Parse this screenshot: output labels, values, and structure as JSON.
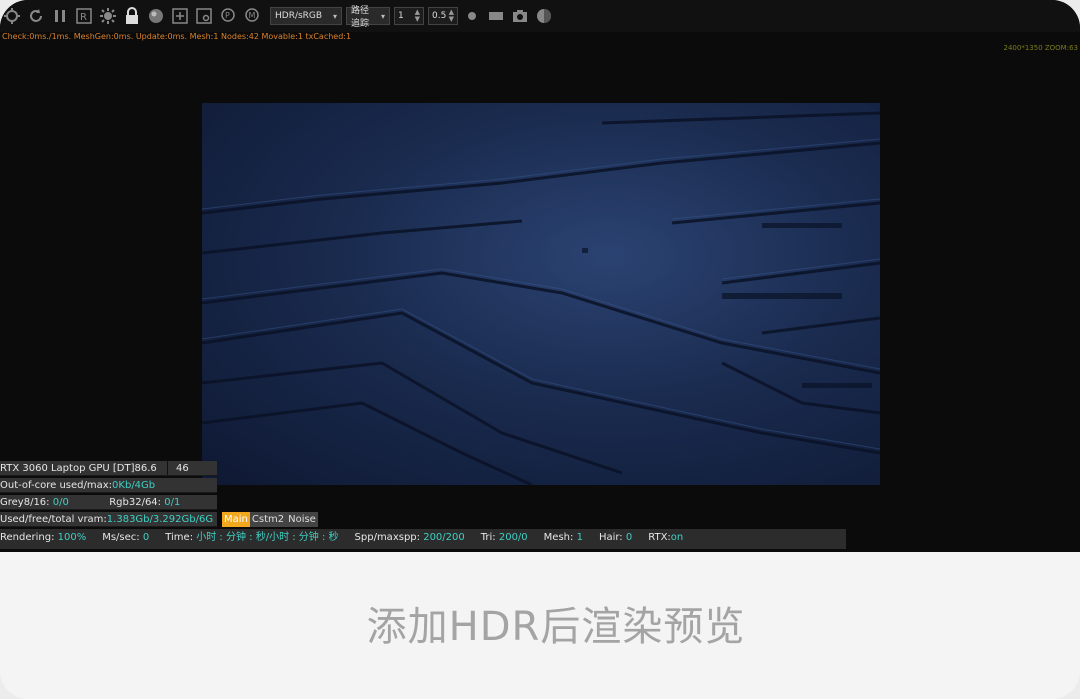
{
  "toolbar": {
    "color_space": "HDR/sRGB",
    "render_mode": "路径追踪",
    "value_a": "1",
    "value_b": "0.5"
  },
  "status_line": "Check:0ms./1ms. MeshGen:0ms. Update:0ms. Mesh:1 Nodes:42 Movable:1 txCached:1",
  "zoom_readout": "2400*1350 ZOOM:63",
  "info": {
    "gpu_name": "RTX 3060 Laptop GPU [DT]",
    "gpu_suffix": "86.6",
    "gpu_value": "46",
    "out_of_core_label": "Out-of-core used/max:",
    "out_of_core_value": "0Kb/4Gb",
    "grey_label": "Grey8/16:",
    "grey_value": "0/0",
    "rgb_label": "Rgb32/64:",
    "rgb_value": "0/1",
    "vram_label": "Used/free/total vram:",
    "vram_value": "1.383Gb/3.292Gb/6G"
  },
  "tabs": [
    "Main",
    "Cstm2",
    "Noise"
  ],
  "render_bar": {
    "rendering_label": "Rendering:",
    "rendering_value": "100%",
    "ms_label": "Ms/sec:",
    "ms_value": "0",
    "time_label": "Time:",
    "time_value": "小时 : 分钟 : 秒/小时 : 分钟 : 秒",
    "spp_label": "Spp/maxspp:",
    "spp_value": "200/200",
    "tri_label": "Tri:",
    "tri_value": "200/0",
    "mesh_label": "Mesh:",
    "mesh_value": "1",
    "hair_label": "Hair:",
    "hair_value": "0",
    "rtx_label": "RTX:",
    "rtx_value": "on"
  },
  "caption": "添加HDR后渲染预览",
  "colors": {
    "accent_orange": "#d9822b",
    "cyan_value": "#3fd0c4",
    "active_tab": "#f2a81d",
    "render_blue": "#1a2b4f"
  }
}
